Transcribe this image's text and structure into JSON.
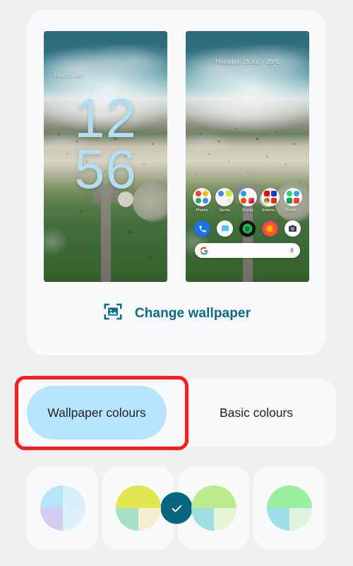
{
  "theme": {
    "page_bg": "#eff0f2",
    "card_bg": "#f8f9fa",
    "accent_teal": "#0b6b85",
    "selected_pill": "#b6e4fb",
    "annotation_red": "#fb1c1c",
    "check_circle": "#076780"
  },
  "preview": {
    "lock_screen": {
      "date": "Thu, 15 Jul",
      "clock_hours": "12",
      "clock_minutes": "56",
      "clock_color": "#b3ddf0"
    },
    "home_screen": {
      "status_text": "Thursday, 15 Jul",
      "status_separator": "·",
      "temperature": "29°C",
      "folders": [
        {
          "label": "Photos",
          "icons": [
            "#ea4335",
            "#fbbc04",
            "#34a853",
            "#4285f4"
          ]
        },
        {
          "label": "Sports",
          "icons": [
            "#4285f4",
            "#ccef23",
            "#ffffff",
            "#f1f3f4"
          ]
        },
        {
          "label": "Social",
          "icons": [
            "#1da1f2",
            "#e1306c",
            "#ff4500",
            "#c13584"
          ]
        },
        {
          "label": "Enterta…",
          "icons": [
            "#ff0000",
            "#113ccf",
            "#ea4335",
            "#d93025"
          ]
        },
        {
          "label": "Comm…",
          "icons": [
            "#25d366",
            "#29a9eb",
            "#1a9c4a",
            "#ea4335"
          ]
        }
      ],
      "dock": [
        {
          "name": "phone",
          "color": "#1a73e8"
        },
        {
          "name": "messages",
          "color": "#ffffff"
        },
        {
          "name": "spotify",
          "color": "#121212"
        },
        {
          "name": "firefox",
          "color": "#3b1a52"
        },
        {
          "name": "camera",
          "color": "#ffffff"
        }
      ],
      "search": {
        "logo": "G",
        "mic": "mic-icon"
      }
    }
  },
  "change_wallpaper": {
    "label": "Change wallpaper",
    "icon": "image-frame-icon"
  },
  "tabs": [
    {
      "label": "Wallpaper colours",
      "selected": true
    },
    {
      "label": "Basic colours",
      "selected": false
    }
  ],
  "colour_swatches": [
    {
      "selected": true,
      "quadrants": [
        "#b8e4f7",
        "#d8effa",
        "#d4cdf4",
        "#ddf0fa"
      ],
      "check": "✓"
    },
    {
      "selected": false,
      "quadrants": [
        "#e1e652",
        "#e1e652",
        "#a5dfc6",
        "#f2f0cf"
      ],
      "check": ""
    },
    {
      "selected": false,
      "quadrants": [
        "#bceb8d",
        "#bceb8d",
        "#9fdee0",
        "#e6f5d6",
        "#9fdee0"
      ],
      "check": ""
    },
    {
      "selected": false,
      "quadrants": [
        "#99ef9e",
        "#99ef9e",
        "#9fdeea",
        "#dff4de"
      ],
      "check": ""
    }
  ]
}
